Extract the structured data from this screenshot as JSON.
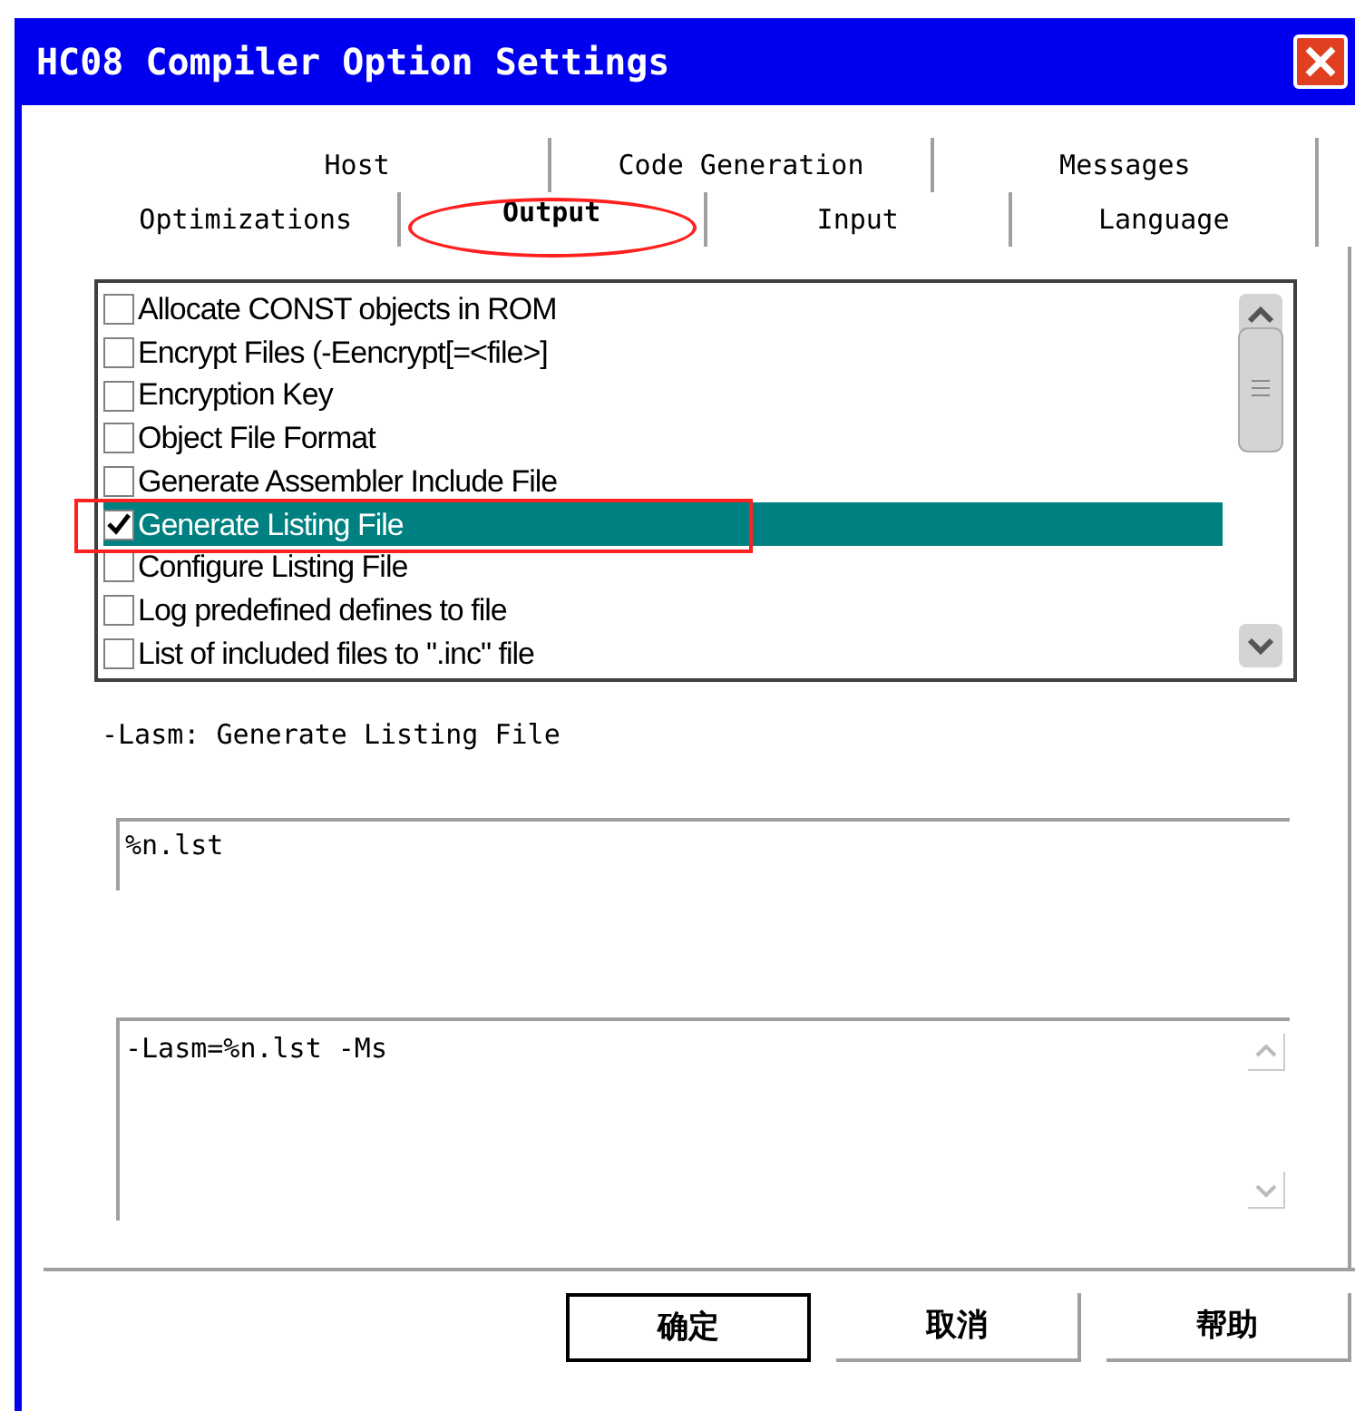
{
  "window": {
    "title": "HC08 Compiler Option Settings"
  },
  "tab_rows": [
    [
      {
        "label": "Host",
        "selected": false
      },
      {
        "label": "Code Generation",
        "selected": false
      },
      {
        "label": "Messages",
        "selected": false
      }
    ],
    [
      {
        "label": "Optimizations",
        "selected": false
      },
      {
        "label": "Output",
        "selected": true
      },
      {
        "label": "Input",
        "selected": false
      },
      {
        "label": "Language",
        "selected": false
      }
    ]
  ],
  "options": [
    {
      "label": "Allocate CONST objects in ROM",
      "checked": false,
      "selected": false
    },
    {
      "label": "Encrypt Files (-Eencrypt[=<file>]",
      "checked": false,
      "selected": false
    },
    {
      "label": "Encryption Key",
      "checked": false,
      "selected": false
    },
    {
      "label": "Object File Format",
      "checked": false,
      "selected": false
    },
    {
      "label": "Generate Assembler Include File",
      "checked": false,
      "selected": false
    },
    {
      "label": "Generate Listing File",
      "checked": true,
      "selected": true
    },
    {
      "label": "Configure Listing File",
      "checked": false,
      "selected": false
    },
    {
      "label": "Log predefined defines to file",
      "checked": false,
      "selected": false
    },
    {
      "label": "List of included files to \".inc\" file",
      "checked": false,
      "selected": false
    }
  ],
  "option_description": "-Lasm: Generate Listing File",
  "option_value": "%n.lst",
  "command_line": "-Lasm=%n.lst -Ms",
  "buttons": [
    {
      "label": "确定",
      "default": true
    },
    {
      "label": "取消",
      "default": false
    },
    {
      "label": "帮助",
      "default": false
    }
  ]
}
